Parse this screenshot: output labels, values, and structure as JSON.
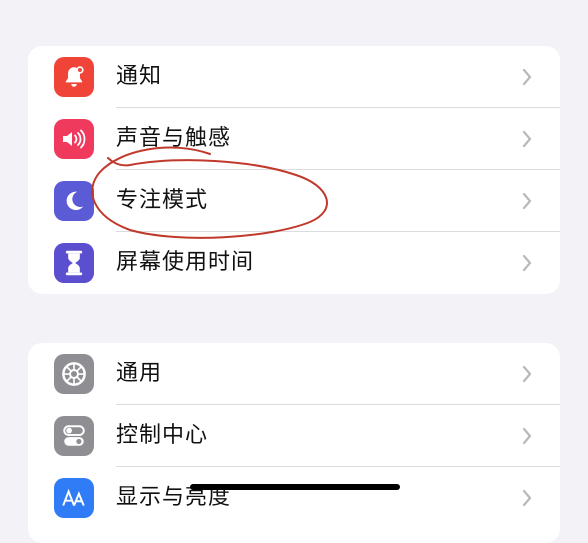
{
  "group1": {
    "items": [
      {
        "label": "通知",
        "icon": "bell-icon",
        "icon_color": "#f04438"
      },
      {
        "label": "声音与触感",
        "icon": "speaker-icon",
        "icon_color": "#ef3a5d"
      },
      {
        "label": "专注模式",
        "icon": "moon-icon",
        "icon_color": "#5b5bd6"
      },
      {
        "label": "屏幕使用时间",
        "icon": "hourglass-icon",
        "icon_color": "#5b4fcf"
      }
    ]
  },
  "group2": {
    "items": [
      {
        "label": "通用",
        "icon": "gear-icon",
        "icon_color": "#8e8e93"
      },
      {
        "label": "控制中心",
        "icon": "toggles-icon",
        "icon_color": "#8e8e93"
      },
      {
        "label": "显示与亮度",
        "icon": "text-size-icon",
        "icon_color": "#2f7cf6"
      }
    ]
  },
  "annotation": {
    "color": "#c0392b"
  }
}
